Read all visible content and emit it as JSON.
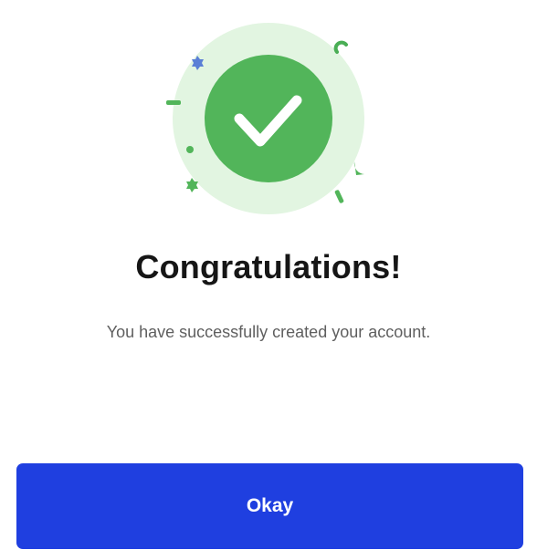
{
  "success_dialog": {
    "title": "Congratulations!",
    "message": "You have successfully created your account.",
    "confirm_label": "Okay",
    "icon": "check-icon"
  },
  "colors": {
    "accent": "#1f3fe0",
    "success_dark": "#52b55a",
    "success_light": "#e2f5e1",
    "confetti_blue": "#5b7fd6"
  }
}
